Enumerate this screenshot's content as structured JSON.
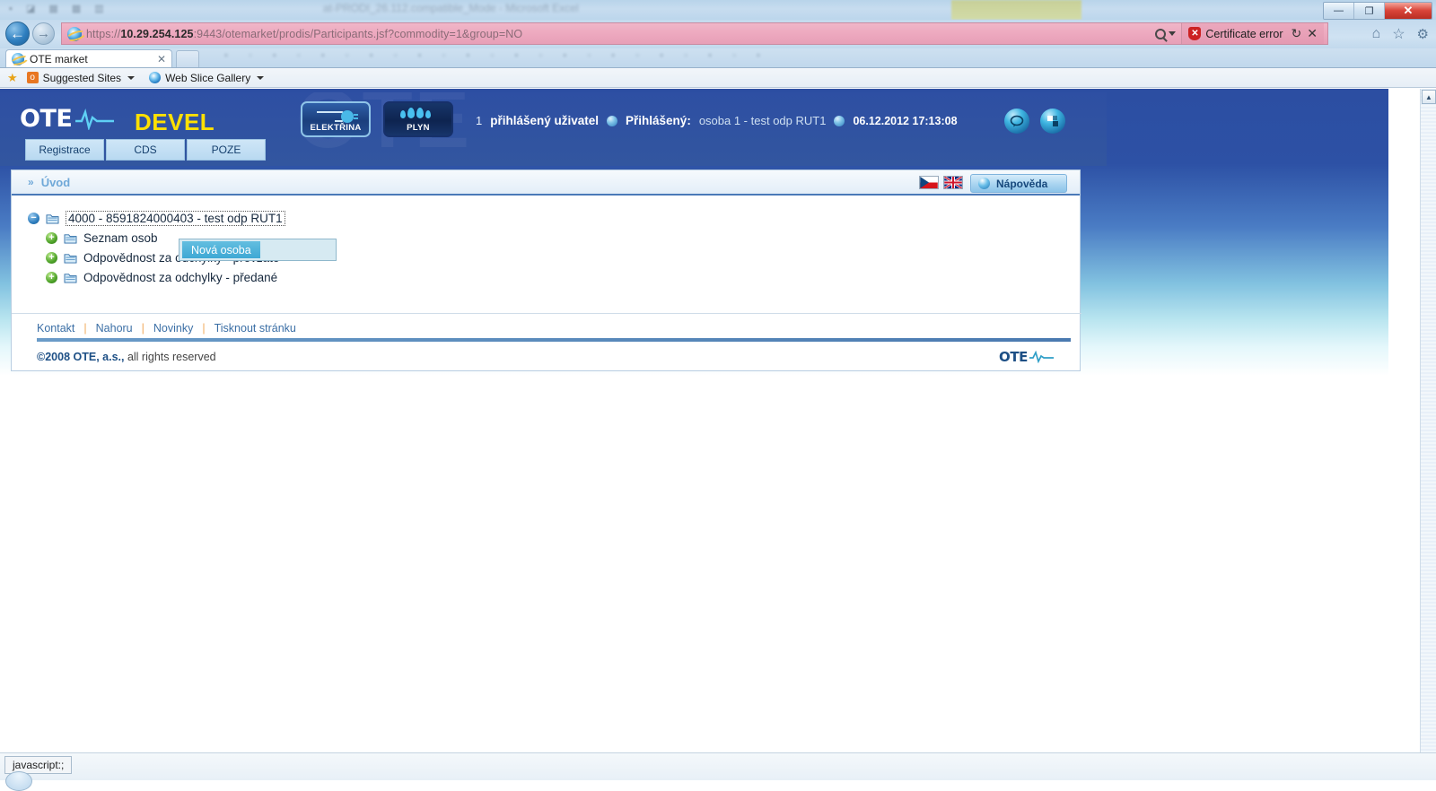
{
  "browser": {
    "ghost_title": "at-PRODI_26.112.compatible_Mode   -  Microsoft Excel",
    "window_controls": {
      "minimize": "—",
      "restore": "❐",
      "close": "✕"
    },
    "nav": {
      "back": "←",
      "forward": "→"
    },
    "address": {
      "scheme": "https://",
      "host": "10.29.254.125",
      "path": ":9443/otemarket/prodis/Participants.jsf?commodity=1&group=NO",
      "search_icon": "search-icon",
      "certificate_error": "Certificate error",
      "refresh": "↻",
      "stop": "✕"
    },
    "chrome_icons": {
      "home": "⌂",
      "favorites": "☆",
      "tools": "⚙"
    },
    "tab": {
      "title": "OTE market",
      "close": "✕"
    },
    "favorites": [
      {
        "label": "Suggested Sites",
        "icon": "orange-square-icon",
        "caret": true
      },
      {
        "label": "Web Slice Gallery",
        "icon": "ie-icon",
        "caret": true
      }
    ],
    "status_text": "javascript:;"
  },
  "app": {
    "logo_text": "OTE",
    "env_label": "DEVEL",
    "nav_tabs": [
      {
        "label": "Registrace"
      },
      {
        "label": "CDS"
      },
      {
        "label": "POZE"
      }
    ],
    "commodity_buttons": [
      {
        "label": "ELEKTŘINA",
        "icon": "plug-icon",
        "active": true
      },
      {
        "label": "PLYN",
        "icon": "gas-drops-icon",
        "active": false
      }
    ],
    "session": {
      "user_count": "1",
      "user_count_label": "přihlášený uživatel",
      "logged_in_label": "Přihlášený:",
      "user_name": "osoba 1 - test odp RUT1",
      "datetime": "06.12.2012 17:13:08"
    },
    "header_icons": [
      {
        "name": "chat-icon"
      },
      {
        "name": "apps-icon"
      }
    ],
    "watermark": "OTE"
  },
  "panel": {
    "breadcrumb": {
      "arrow": "»",
      "label": "Úvod"
    },
    "languages": [
      {
        "code": "cs",
        "name": "czech-flag"
      },
      {
        "code": "en",
        "name": "uk-flag"
      }
    ],
    "help_button": "Nápověda",
    "tree": [
      {
        "level": 0,
        "toggle": "minus",
        "label": "4000 - 8591824000403 - test odp RUT1",
        "focused": true
      },
      {
        "level": 1,
        "toggle": "plus",
        "label": "Seznam osob",
        "focused": false
      },
      {
        "level": 1,
        "toggle": "plus",
        "label": "Odpovědnost za odchylky - převzaté",
        "focused": false
      },
      {
        "level": 1,
        "toggle": "plus",
        "label": "Odpovědnost za odchylky - předané",
        "focused": false
      }
    ],
    "context_menu": {
      "items": [
        {
          "label": "Nová osoba",
          "highlighted": true
        }
      ]
    }
  },
  "footer": {
    "links": [
      {
        "label": "Kontakt"
      },
      {
        "label": "Nahoru"
      },
      {
        "label": "Novinky"
      },
      {
        "label": "Tisknout stránku"
      }
    ],
    "separator": "|",
    "copyright_year": "©2008",
    "copyright_company": "OTE, a.s.,",
    "copyright_rest": " all rights reserved",
    "logo_text": "OTE"
  },
  "colors": {
    "header_blue": "#2e4fa3",
    "accent_yellow": "#ffe000",
    "link_blue": "#3a6ea5",
    "crumb_blue": "#6fa8d8",
    "ctx_highlight": "#3ea8d4",
    "cert_error_red": "#cc2222",
    "address_bar_pink": "#eda9bf"
  }
}
